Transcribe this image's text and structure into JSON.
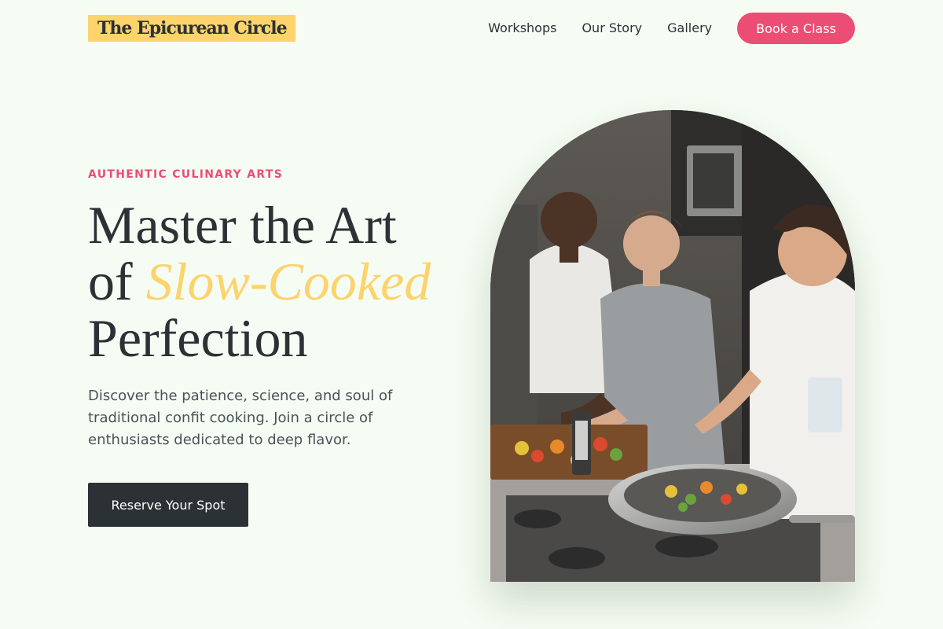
{
  "header": {
    "logo": "The Epicurean Circle",
    "nav": [
      "Workshops",
      "Our Story",
      "Gallery"
    ],
    "cta": "Book a Class"
  },
  "hero": {
    "eyebrow": "AUTHENTIC CULINARY ARTS",
    "headline_line1": "Master the Art",
    "headline_of": "of",
    "headline_accent": "Slow-Cooked",
    "headline_line3": "Perfection",
    "description": "Discover the patience, science, and soul of traditional confit cooking. Join a circle of enthusiasts dedicated to deep flavor.",
    "button": "Reserve Your Spot"
  },
  "image": {
    "subject": "people-cooking-in-kitchen-photo"
  },
  "colors": {
    "background": "#f5fcf3",
    "accent_pink": "#ec4d75",
    "accent_yellow": "#fcd36c",
    "dark": "#2b3134"
  }
}
